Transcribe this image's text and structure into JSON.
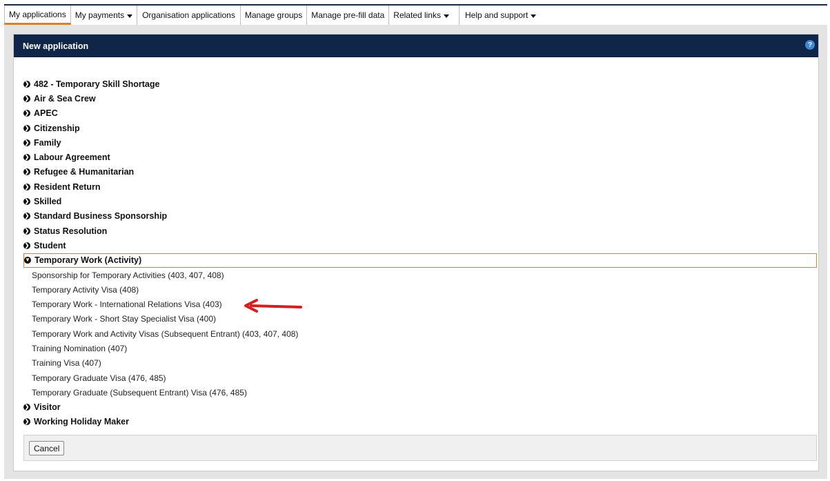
{
  "nav": {
    "tabs": [
      {
        "label": "My applications",
        "dropdown": false
      },
      {
        "label": "My payments",
        "dropdown": true
      },
      {
        "label": "Organisation applications",
        "dropdown": false
      },
      {
        "label": "Manage groups",
        "dropdown": false
      },
      {
        "label": "Manage pre-fill data",
        "dropdown": false
      },
      {
        "label": "Related links",
        "dropdown": true
      },
      {
        "label": "Help and support",
        "dropdown": true
      }
    ]
  },
  "panel": {
    "title": "New application",
    "help_icon": "?"
  },
  "categories_top": [
    "482 - Temporary Skill Shortage",
    "Air & Sea Crew",
    "APEC",
    "Citizenship",
    "Family",
    "Labour Agreement",
    "Refugee & Humanitarian",
    "Resident Return",
    "Skilled",
    "Standard Business Sponsorship",
    "Status Resolution",
    "Student"
  ],
  "expanded_category": "Temporary Work (Activity)",
  "sub_items": [
    "Sponsorship for Temporary Activities (403, 407, 408)",
    "Temporary Activity Visa (408)",
    "Temporary Work - International Relations Visa (403)",
    "Temporary Work - Short Stay Specialist Visa (400)",
    "Temporary Work and Activity Visas (Subsequent Entrant) (403, 407, 408)",
    "Training Nomination (407)",
    "Training Visa (407)",
    "Temporary Graduate Visa (476, 485)",
    "Temporary Graduate (Subsequent Entrant) Visa (476, 485)"
  ],
  "categories_bottom": [
    "Visitor",
    "Working Holiday Maker"
  ],
  "footer": {
    "cancel_label": "Cancel"
  },
  "colors": {
    "header_bg": "#0f2648",
    "accent_orange": "#d9822b",
    "arrow_red": "#d2201f"
  }
}
